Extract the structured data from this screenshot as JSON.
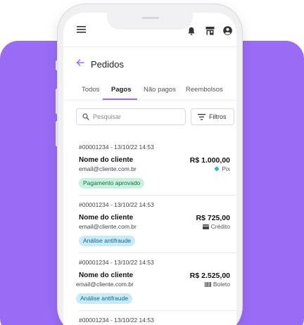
{
  "screen": {
    "title": "Pedidos",
    "tabs": [
      {
        "label": "Todos",
        "active": false
      },
      {
        "label": "Pagos",
        "active": true
      },
      {
        "label": "Não pagos",
        "active": false
      },
      {
        "label": "Reembolsos",
        "active": false
      }
    ],
    "search": {
      "placeholder": "Pesquisar"
    },
    "filter_label": "Filtros"
  },
  "orders": [
    {
      "id_time": "#00001234 - 13/10/22 14:53",
      "name": "Nome do cliente",
      "email": "email@cliente.com.br",
      "value": "R$ 1.000,00",
      "method": "Pix",
      "status": "Pagamento aprovado"
    },
    {
      "id_time": "#00001234 - 13/10/22 14:53",
      "name": "Nome do cliente",
      "email": "email@cliente.com.br",
      "value": "R$ 725,00",
      "method": "Crédito",
      "status": "Análise antifraude"
    },
    {
      "id_time": "#00001234 - 13/10/22 14:53",
      "name": "Nome do cliente",
      "email": "email@cliente.com.br",
      "value": "R$ 2.525,00",
      "method": "Boleto",
      "status": "Análise antifraude"
    },
    {
      "id_time": "#00001234 - 13/10/22 14:53"
    }
  ],
  "colors": {
    "accent": "#9a6cf6",
    "approved_bg": "#c8f2dd",
    "review_bg": "#c6ecfb",
    "pix": "#32bcad"
  },
  "icons": [
    "menu-icon",
    "bell-icon",
    "store-icon",
    "account-icon",
    "back-arrow-icon",
    "search-icon",
    "filter-icon",
    "pix-icon",
    "card-icon",
    "barcode-icon"
  ]
}
